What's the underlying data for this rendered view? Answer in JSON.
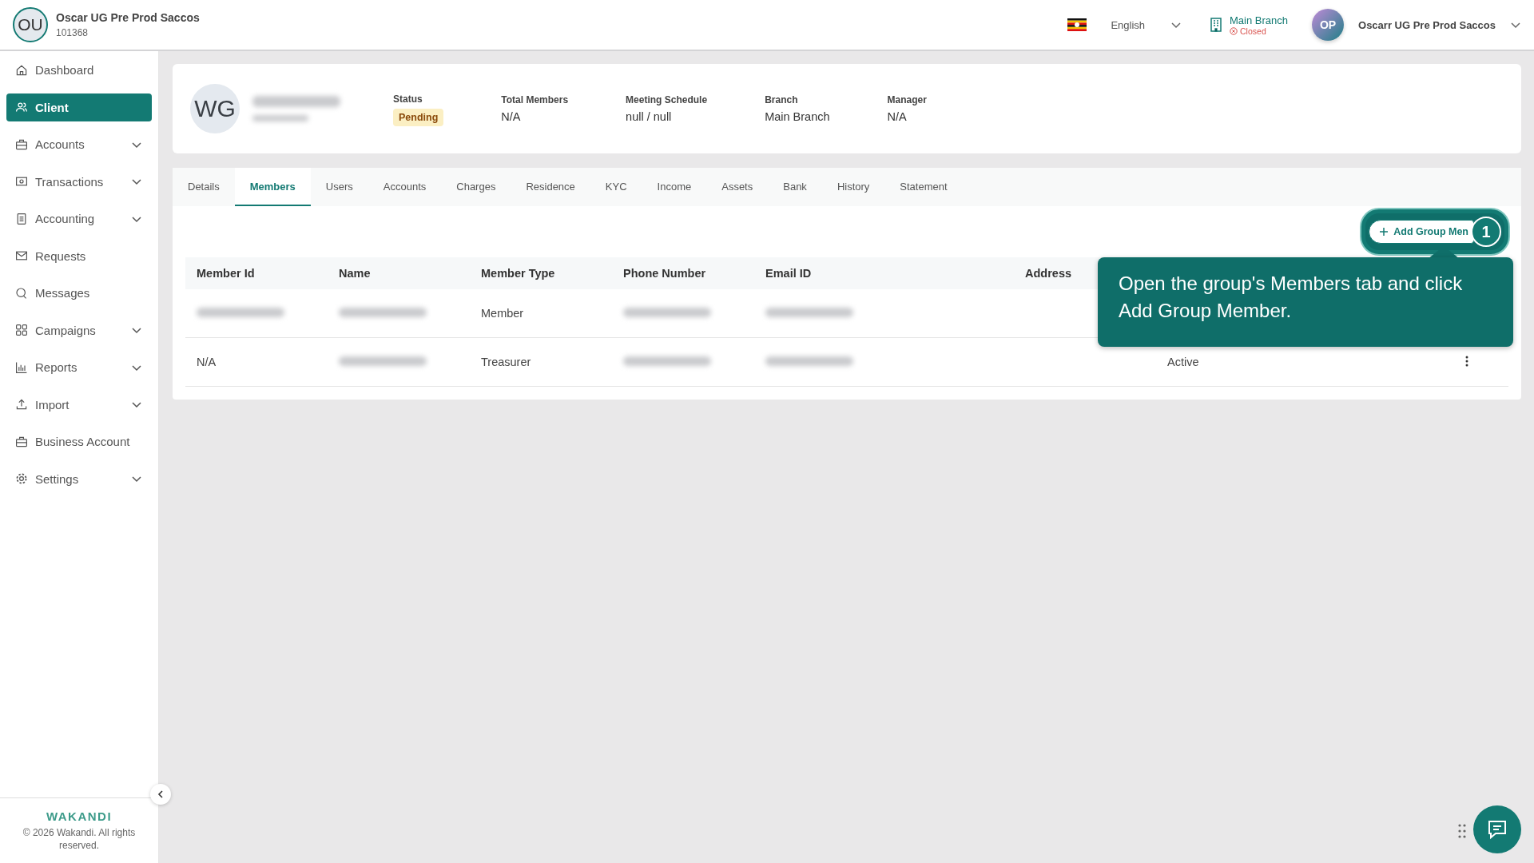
{
  "org": {
    "avatar": "OU",
    "name": "Oscar UG Pre Prod Saccos",
    "code": "101368"
  },
  "topbar": {
    "language": "English",
    "branch": {
      "name": "Main Branch",
      "status": "Closed"
    },
    "user": {
      "avatar": "OP",
      "name": "Oscarr UG Pre Prod Saccos"
    }
  },
  "sidebar": {
    "items": [
      {
        "label": "Dashboard",
        "selected": false,
        "expandable": false
      },
      {
        "label": "Client",
        "selected": true,
        "expandable": false
      },
      {
        "label": "Accounts",
        "selected": false,
        "expandable": true
      },
      {
        "label": "Transactions",
        "selected": false,
        "expandable": true
      },
      {
        "label": "Accounting",
        "selected": false,
        "expandable": true
      },
      {
        "label": "Requests",
        "selected": false,
        "expandable": false
      },
      {
        "label": "Messages",
        "selected": false,
        "expandable": false
      },
      {
        "label": "Campaigns",
        "selected": false,
        "expandable": true
      },
      {
        "label": "Reports",
        "selected": false,
        "expandable": true
      },
      {
        "label": "Import",
        "selected": false,
        "expandable": true
      },
      {
        "label": "Business Account",
        "selected": false,
        "expandable": false
      },
      {
        "label": "Settings",
        "selected": false,
        "expandable": true
      }
    ],
    "footer": {
      "brand": "WAKANDI",
      "copyright": "© 2026 Wakandi. All rights reserved."
    }
  },
  "group": {
    "avatar": "WG",
    "fields": [
      {
        "label": "Status",
        "value": "Pending",
        "kind": "badge"
      },
      {
        "label": "Total Members",
        "value": "N/A",
        "kind": "text"
      },
      {
        "label": "Meeting Schedule",
        "value": "null / null",
        "kind": "text"
      },
      {
        "label": "Branch",
        "value": "Main Branch",
        "kind": "text"
      },
      {
        "label": "Manager",
        "value": "N/A",
        "kind": "text"
      }
    ]
  },
  "tabs": [
    {
      "label": "Details",
      "selected": false
    },
    {
      "label": "Members",
      "selected": true
    },
    {
      "label": "Users",
      "selected": false
    },
    {
      "label": "Accounts",
      "selected": false
    },
    {
      "label": "Charges",
      "selected": false
    },
    {
      "label": "Residence",
      "selected": false
    },
    {
      "label": "KYC",
      "selected": false
    },
    {
      "label": "Income",
      "selected": false
    },
    {
      "label": "Assets",
      "selected": false
    },
    {
      "label": "Bank",
      "selected": false
    },
    {
      "label": "History",
      "selected": false
    },
    {
      "label": "Statement",
      "selected": false
    }
  ],
  "add_button": "Add Group Men",
  "table": {
    "columns": [
      "Member Id",
      "Name",
      "Member Type",
      "Phone Number",
      "Email ID",
      "Address"
    ],
    "rows": [
      {
        "menu": false,
        "cells": [
          {
            "kind": "redacted"
          },
          {
            "kind": "redacted"
          },
          {
            "kind": "text",
            "text": "Member"
          },
          {
            "kind": "redacted"
          },
          {
            "kind": "redacted"
          },
          {
            "kind": "empty"
          },
          {
            "kind": "empty"
          }
        ]
      },
      {
        "menu": true,
        "cells": [
          {
            "kind": "text",
            "text": "N/A"
          },
          {
            "kind": "redacted"
          },
          {
            "kind": "text",
            "text": "Treasurer"
          },
          {
            "kind": "redacted"
          },
          {
            "kind": "redacted"
          },
          {
            "kind": "empty"
          },
          {
            "kind": "text",
            "text": "Active"
          }
        ]
      }
    ]
  },
  "tour": {
    "step": "1",
    "text": "Open the group's Members tab and click Add Group Member."
  }
}
